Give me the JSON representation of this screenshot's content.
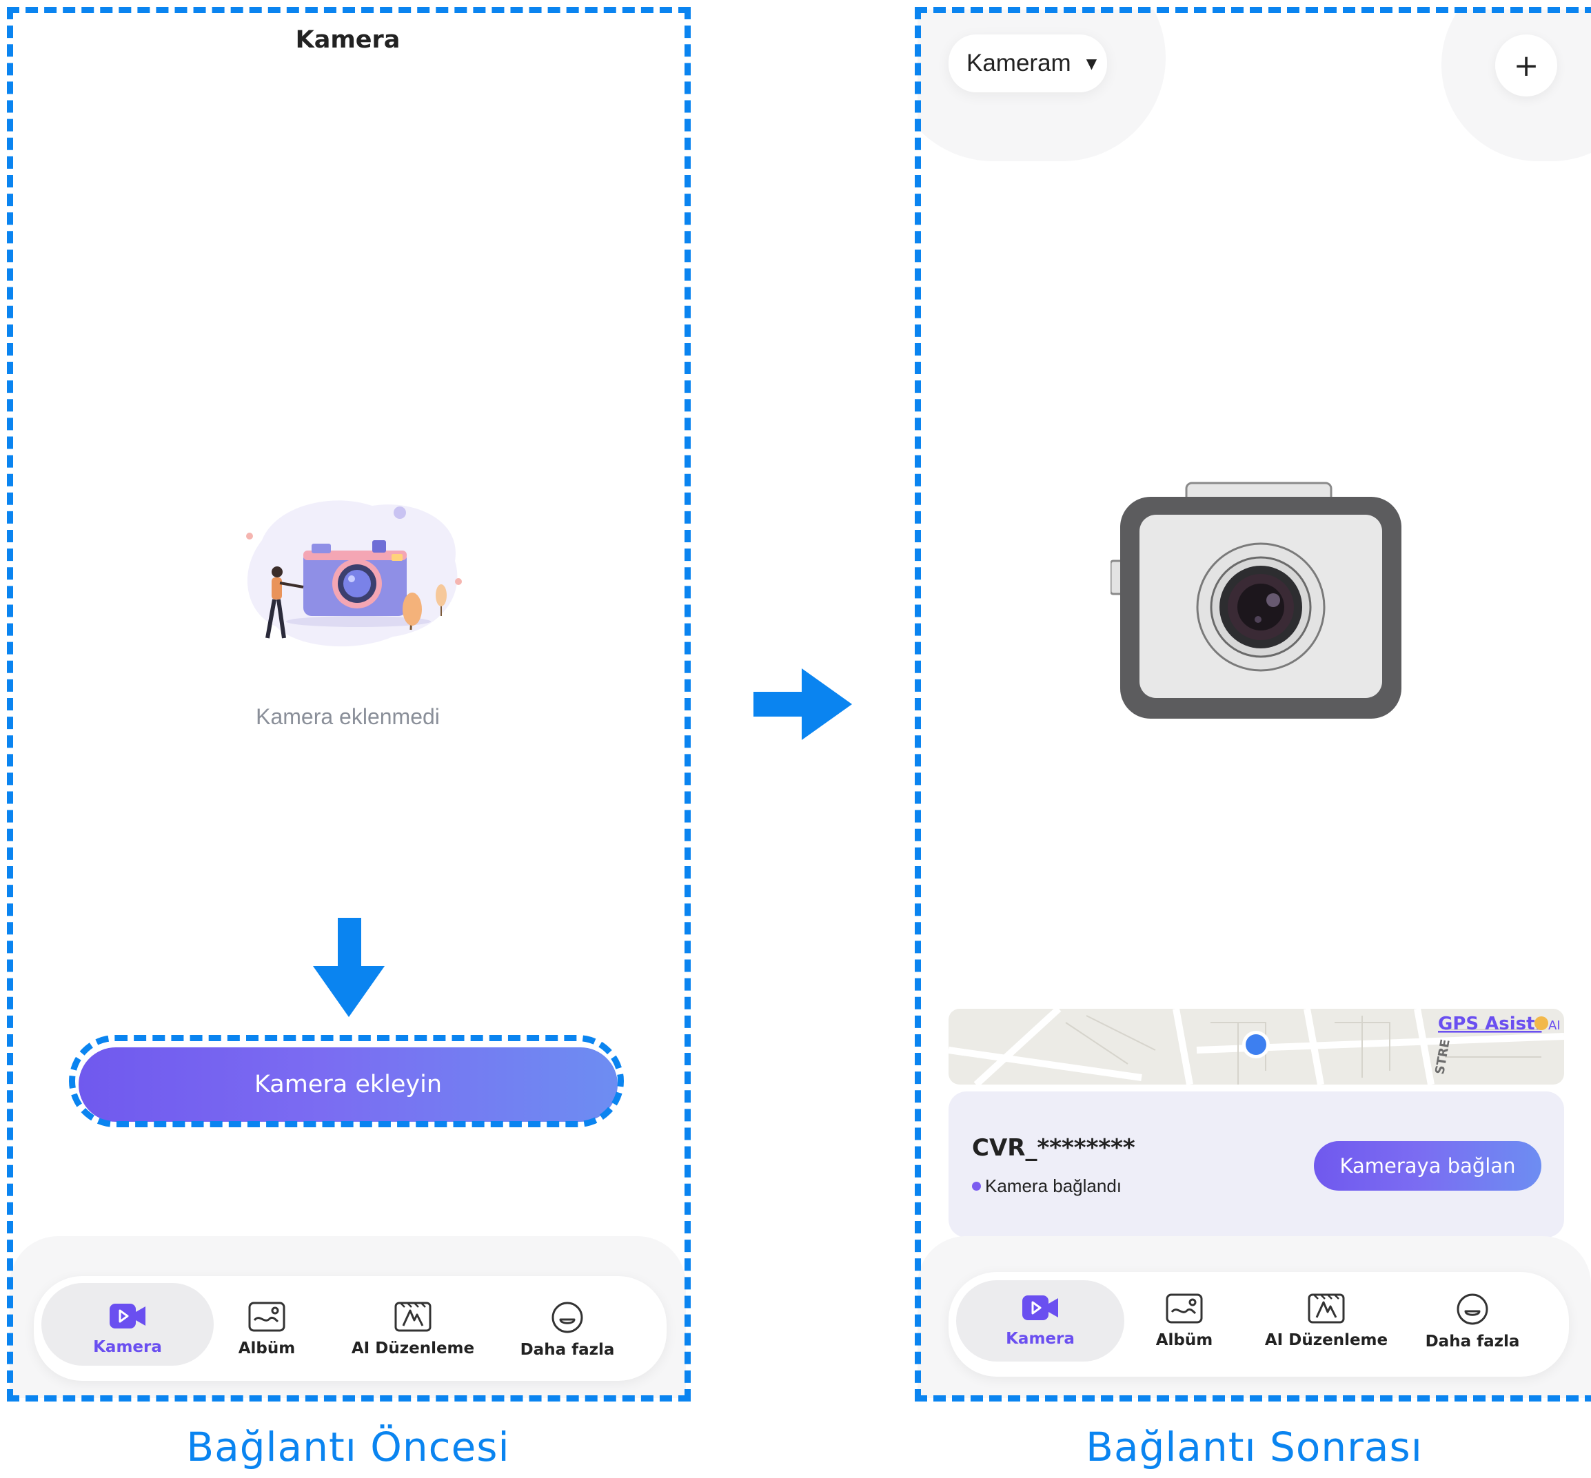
{
  "before": {
    "title": "Kamera",
    "empty_message": "Kamera eklenmedi",
    "add_button_label": "Kamera ekleyin",
    "caption": "Bağlantı Öncesi"
  },
  "after": {
    "camera_selector_label": "Kameram",
    "add_icon_glyph": "+",
    "map_badge_text": "GPS Asist.",
    "map_badge_suffix": "AI",
    "map_street_text": "STRE",
    "device_name": "CVR_********",
    "device_status": "Kamera bağlandı",
    "connect_button_label": "Kameraya bağlan",
    "caption": "Bağlantı Sonrası"
  },
  "tabs": [
    {
      "label": "Kamera",
      "icon": "video-camera-icon",
      "active": true
    },
    {
      "label": "Albüm",
      "icon": "album-icon",
      "active": false
    },
    {
      "label": "AI Düzenleme",
      "icon": "ai-edit-icon",
      "active": false
    },
    {
      "label": "Daha fazla",
      "icon": "more-face-icon",
      "active": false
    }
  ],
  "colors": {
    "annotation_blue": "#0a84f0",
    "accent_purple": "#6a4ff0",
    "button_gradient_start": "#7059ee",
    "button_gradient_end": "#6d8df2",
    "status_dot": "#7b5cf0"
  }
}
